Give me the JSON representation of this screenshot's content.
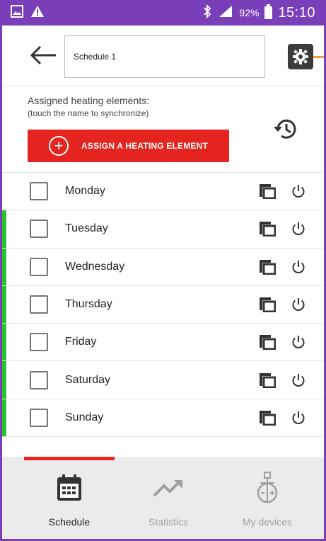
{
  "status_bar": {
    "battery": "92%",
    "time": "15:10"
  },
  "header": {
    "schedule_name": "Schedule 1"
  },
  "assign": {
    "title": "Assigned heating elements:",
    "subtitle": "(touch the name to synchronize)",
    "button_label": "ASSIGN A HEATING ELEMENT"
  },
  "days": [
    {
      "label": "Monday",
      "active": false
    },
    {
      "label": "Tuesday",
      "active": true
    },
    {
      "label": "Wednesday",
      "active": true
    },
    {
      "label": "Thursday",
      "active": true
    },
    {
      "label": "Friday",
      "active": true
    },
    {
      "label": "Saturday",
      "active": true
    },
    {
      "label": "Sunday",
      "active": true
    }
  ],
  "bottom_nav": {
    "items": [
      {
        "label": "Schedule",
        "icon": "calendar-icon",
        "active": true
      },
      {
        "label": "Statistics",
        "icon": "trend-icon",
        "active": false
      },
      {
        "label": "My devices",
        "icon": "thermostat-icon",
        "active": false
      }
    ]
  },
  "colors": {
    "status_bar": "#7a3fb8",
    "accent_red": "#e52420",
    "active_green": "#27c22c",
    "orange_dash": "#f29a45"
  }
}
